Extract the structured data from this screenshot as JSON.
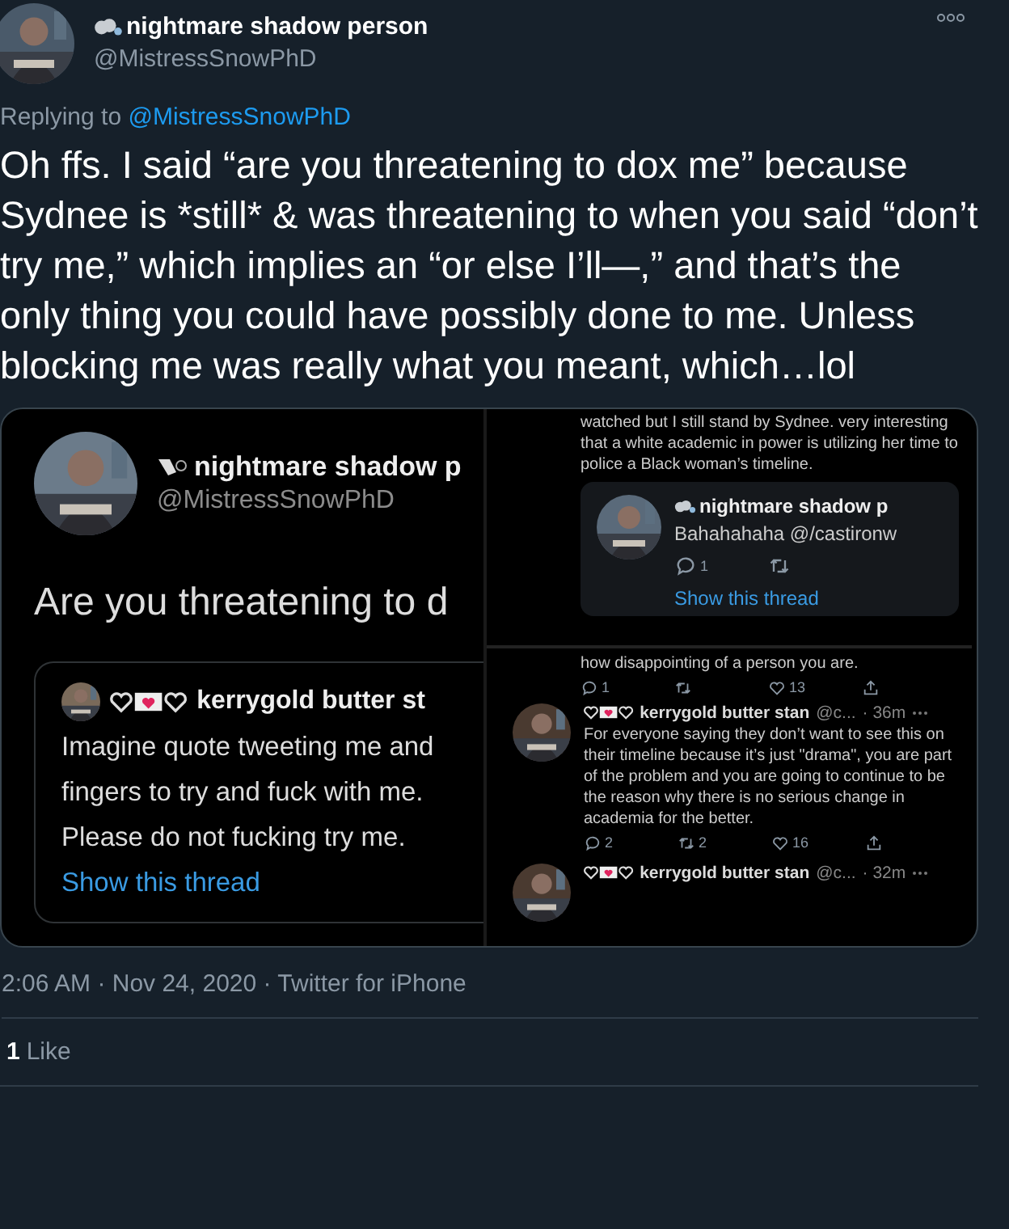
{
  "tweet": {
    "author": {
      "name": "nightmare shadow person",
      "handle": "@MistressSnowPhD"
    },
    "reply_to": {
      "label": "Replying to",
      "handle": "@MistressSnowPhD"
    },
    "text": "Oh ffs. I said “are you threatening to dox me” because Sydnee is *still* & was threatening to when you said “don’t try me,” which implies an “or else I’ll—,” and that’s the only thing you could have possibly done to me. Unless blocking me was really what you meant, which…lol",
    "media": {
      "left": {
        "name": "nightmare shadow p",
        "handle": "@MistressSnowPhD",
        "text": "Are you threatening to d",
        "quote": {
          "name": "kerrygold butter st",
          "lines": [
            "Imagine quote tweeting me and",
            "fingers to try and fuck with me.",
            "Please do not fucking try me."
          ],
          "link": "Show this thread"
        }
      },
      "right_top": {
        "text": "watched but I still stand by Sydnee. very interesting that a white academic in power is utilizing her time to police a Black woman’s timeline.",
        "quote": {
          "name": "nightmare shadow p",
          "text": "Bahahahaha @/castironw",
          "actions": [
            {
              "kind": "reply",
              "count": "1"
            },
            {
              "kind": "retweet"
            }
          ],
          "link": "Show this thread"
        }
      },
      "right_bottom": {
        "text": "how disappointing of a person you are.",
        "actions": [
          {
            "kind": "reply",
            "count": "1"
          },
          {
            "kind": "retweet"
          },
          {
            "kind": "like",
            "count": "13"
          },
          {
            "kind": "share"
          }
        ],
        "tweets": [
          {
            "name": "kerrygold butter stan",
            "handle": "@c...",
            "time": "· 36m",
            "text": "For everyone saying they don’t want to see this on their timeline because it’s just \"drama\", you are part of the problem and you are going to continue to be the reason why there is no serious change in academia for the better.",
            "actions": [
              {
                "kind": "reply",
                "count": "2"
              },
              {
                "kind": "retweet",
                "count": "2"
              },
              {
                "kind": "like",
                "count": "16"
              },
              {
                "kind": "share"
              }
            ]
          },
          {
            "name": "kerrygold butter stan",
            "handle": "@c...",
            "time": "· 32m"
          }
        ]
      }
    },
    "timestamp": "2:06 AM · Nov 24, 2020 · Twitter for iPhone",
    "likes": {
      "count": "1",
      "label": "Like"
    }
  }
}
